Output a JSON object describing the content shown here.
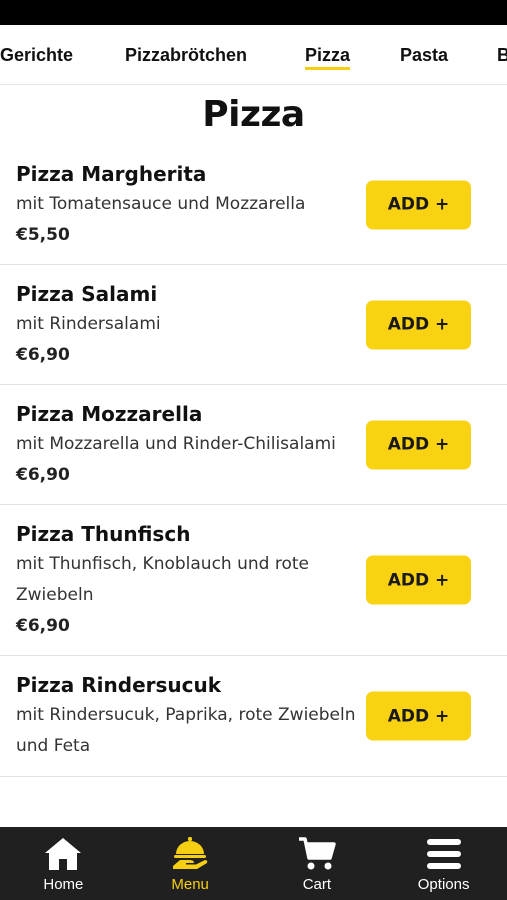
{
  "categories": [
    {
      "label": "Gerichte",
      "active": false
    },
    {
      "label": "Pizzabrötchen",
      "active": false
    },
    {
      "label": "Pizza",
      "active": true
    },
    {
      "label": "Pasta",
      "active": false
    },
    {
      "label": "B",
      "active": false
    }
  ],
  "section": {
    "title": "Pizza"
  },
  "items": [
    {
      "name": "Pizza Margherita",
      "desc": "mit Tomatensauce und Mozzarella",
      "price": "€5,50",
      "button": "ADD +"
    },
    {
      "name": "Pizza Salami",
      "desc": "mit Rindersalami",
      "price": "€6,90",
      "button": "ADD +"
    },
    {
      "name": "Pizza Mozzarella",
      "desc": "mit Mozzarella und Rinder-Chilisalami",
      "price": "€6,90",
      "button": "ADD +"
    },
    {
      "name": "Pizza Thunfisch",
      "desc": "mit Thunfisch, Knoblauch und rote Zwiebeln",
      "price": "€6,90",
      "button": "ADD +"
    },
    {
      "name": "Pizza Rindersucuk",
      "desc": "mit Rindersucuk, Paprika, rote Zwiebeln und Feta",
      "price": "",
      "button": "ADD +"
    }
  ],
  "nav": [
    {
      "label": "Home",
      "icon": "home-icon",
      "active": false
    },
    {
      "label": "Menu",
      "icon": "serving-hand-icon",
      "active": true
    },
    {
      "label": "Cart",
      "icon": "cart-icon",
      "active": false
    },
    {
      "label": "Options",
      "icon": "hamburger-menu-icon",
      "active": false
    }
  ],
  "colors": {
    "accent": "#f9d312",
    "navbar": "#202020",
    "statusbar": "#000000"
  }
}
